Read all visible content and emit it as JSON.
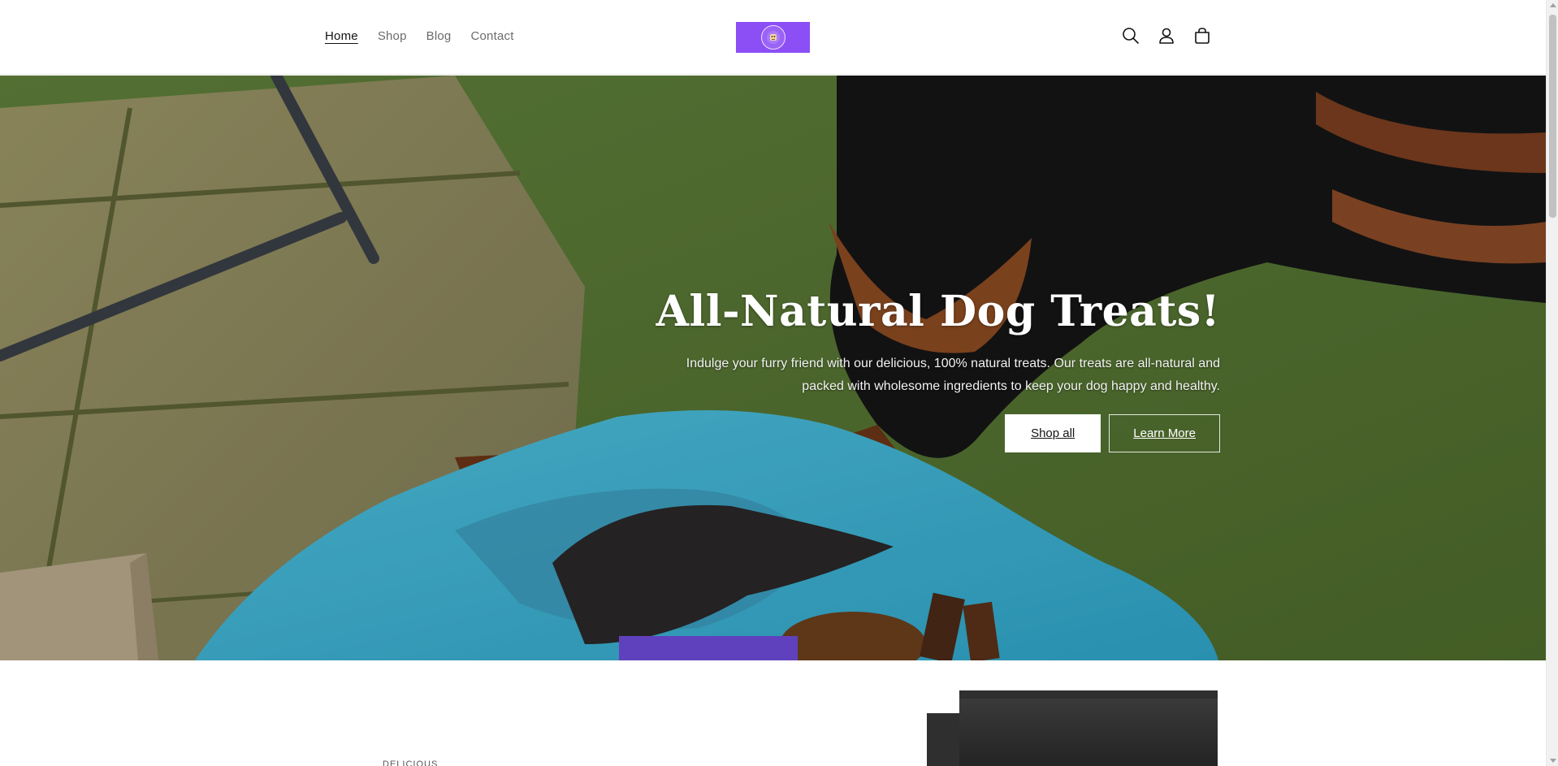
{
  "header": {
    "nav": [
      {
        "label": "Home",
        "active": true
      },
      {
        "label": "Shop",
        "active": false
      },
      {
        "label": "Blog",
        "active": false
      },
      {
        "label": "Contact",
        "active": false
      }
    ],
    "logo_color": "#8b4ff5",
    "icons": [
      "search-icon",
      "account-icon",
      "cart-icon"
    ]
  },
  "hero": {
    "title": "All-Natural Dog Treats!",
    "subtitle_line1": "Indulge your furry friend with our delicious, 100% natural treats. Our treats are all-natural and",
    "subtitle_line2": "packed with wholesome ingredients to keep your dog happy and healthy.",
    "primary_button": "Shop all",
    "secondary_button": "Learn More"
  },
  "below": {
    "caption_snippet": "DELICIOUS"
  }
}
